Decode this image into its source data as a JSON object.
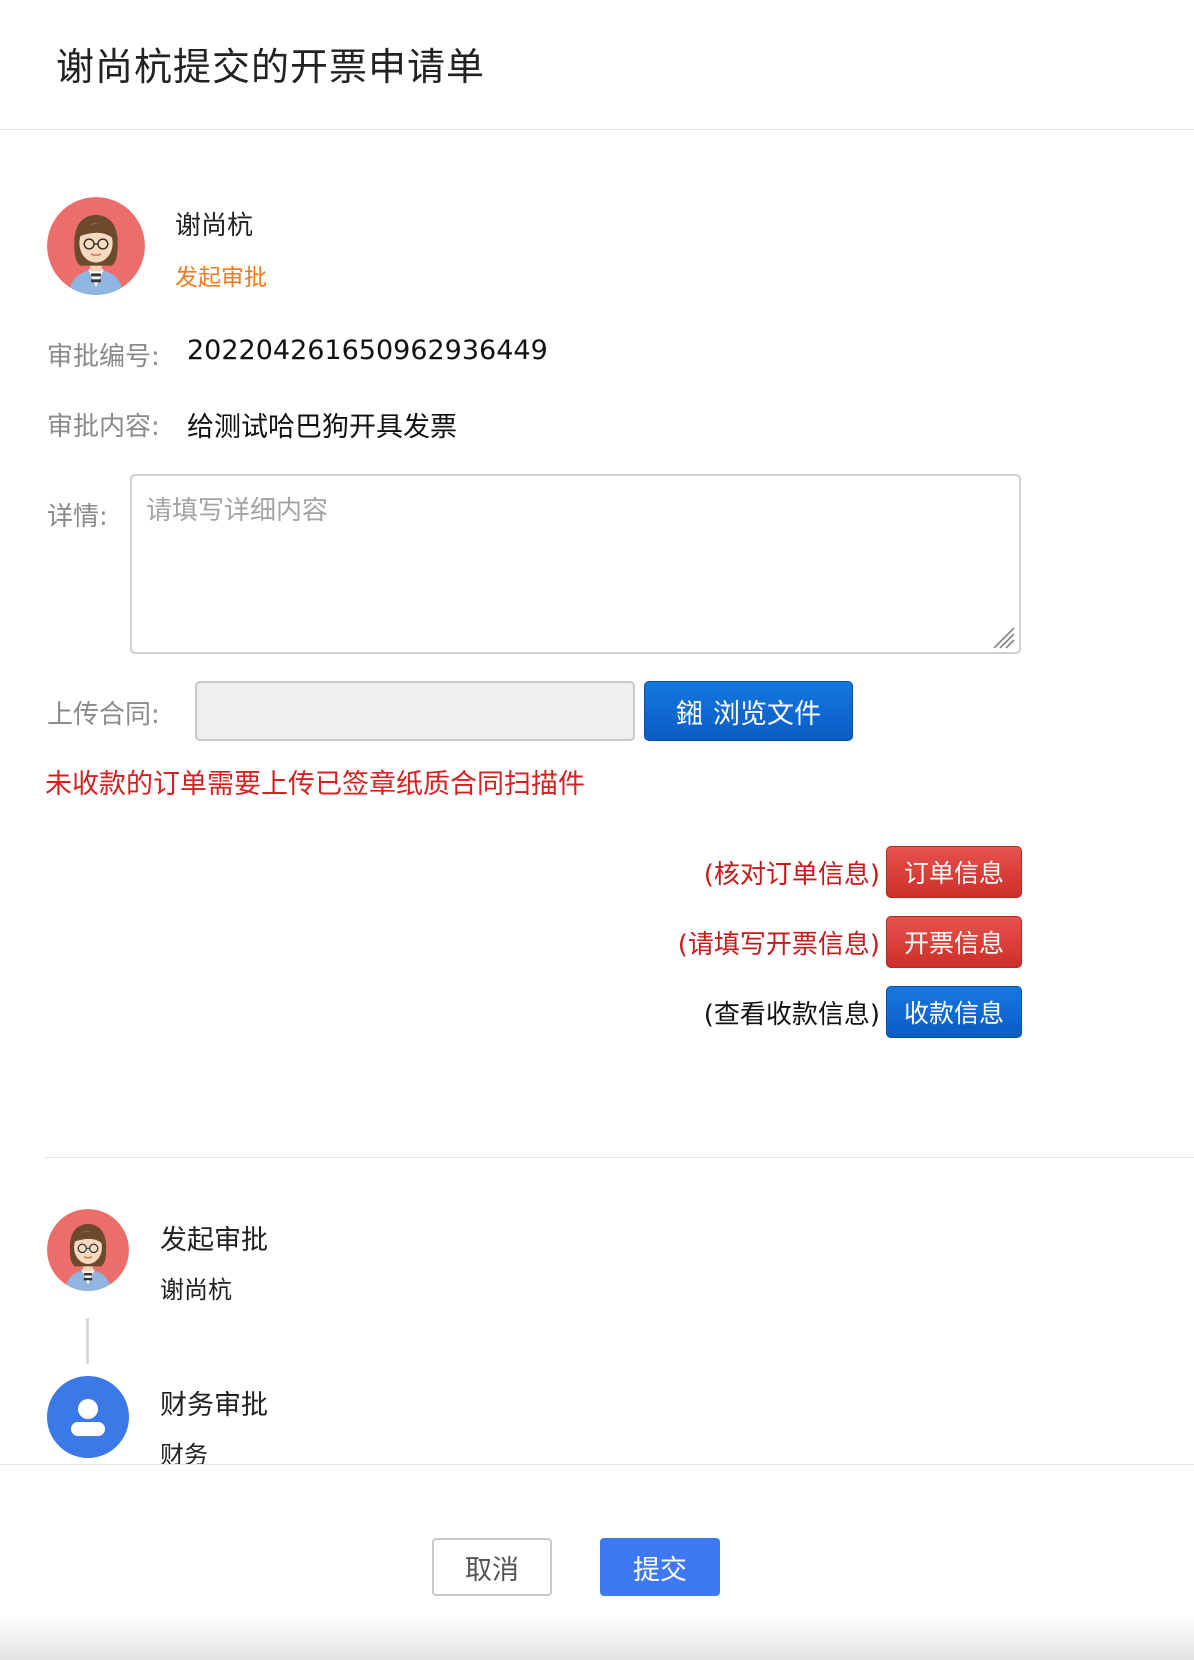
{
  "header": {
    "title": "谢尚杭提交的开票申请单"
  },
  "applicant": {
    "name": "谢尚杭",
    "status": "发起审批"
  },
  "fields": {
    "number_label": "审批编号:",
    "number_value": "202204261650962936449",
    "content_label": "审批内容:",
    "content_value": "给测试哈巴狗开具发票",
    "detail_label": "详情:",
    "detail_placeholder": "请填写详细内容",
    "upload_label": "上传合同:",
    "browse_label": "浏览文件",
    "browse_icon_glyph": "鎺"
  },
  "warning": "未收款的订单需要上传已签章纸质合同扫描件",
  "actions": [
    {
      "hint": "(核对订单信息)",
      "label": "订单信息",
      "color": "#d9403a"
    },
    {
      "hint": "(请填写开票信息)",
      "label": "开票信息",
      "color": "#d9403a"
    },
    {
      "hint": "(查看收款信息)",
      "label": "收款信息",
      "color": "#0f66d0"
    }
  ],
  "flow": [
    {
      "title": "发起审批",
      "person": "谢尚杭"
    },
    {
      "title": "财务审批",
      "person": "财务"
    }
  ],
  "footer": {
    "cancel": "取消",
    "submit": "提交"
  },
  "colors": {
    "accent": "#3f78f3",
    "status_orange": "#f07a22",
    "warning_red": "#d42020"
  }
}
